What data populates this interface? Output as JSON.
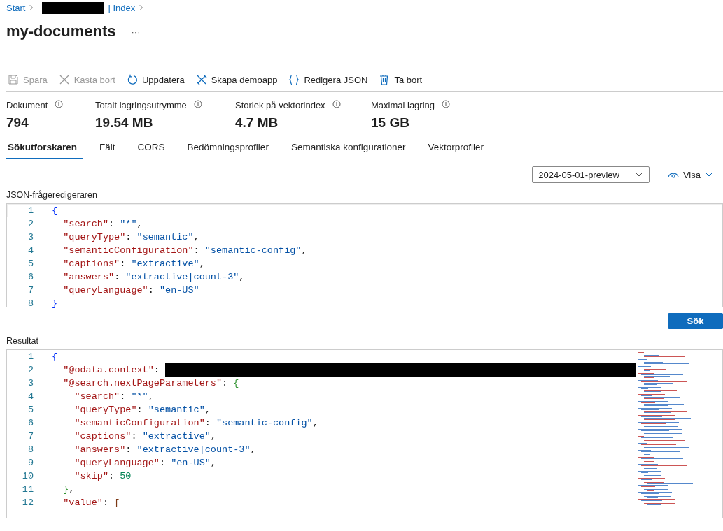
{
  "breadcrumb": [
    {
      "text": "Start",
      "kind": "link"
    },
    {
      "kind": "redacted"
    },
    {
      "text": "| Index",
      "kind": "link"
    }
  ],
  "title": "my-documents",
  "more": "···",
  "toolbar": [
    {
      "label": "Spara",
      "kind": "save",
      "disabled": true
    },
    {
      "label": "Kasta bort",
      "kind": "discard",
      "disabled": true
    },
    {
      "label": "Uppdatera",
      "kind": "refresh",
      "disabled": false
    },
    {
      "label": "Skapa demoapp",
      "kind": "tools",
      "disabled": false
    },
    {
      "label": "Redigera JSON",
      "kind": "braces",
      "disabled": false
    },
    {
      "label": "Ta bort",
      "kind": "trash",
      "disabled": false
    }
  ],
  "stats": [
    {
      "label": "Dokument",
      "value": "794"
    },
    {
      "label": "Totalt lagringsutrymme",
      "value": "19.54 MB"
    },
    {
      "label": "Storlek på vektorindex",
      "value": "4.7 MB"
    },
    {
      "label": "Maximal lagring",
      "value": "15 GB"
    }
  ],
  "tabs": [
    {
      "label": "Sökutforskaren",
      "selected": true
    },
    {
      "label": "Fält",
      "selected": false
    },
    {
      "label": "CORS",
      "selected": false
    },
    {
      "label": "Bedömningsprofiler",
      "selected": false
    },
    {
      "label": "Semantiska konfigurationer",
      "selected": false
    },
    {
      "label": "Vektorprofiler",
      "selected": false
    }
  ],
  "api_version": {
    "value": "2024-05-01-preview"
  },
  "view_button": "Visa",
  "query_editor": {
    "label": "JSON-frågeredigeraren",
    "lines": [
      {
        "number": "1",
        "tokens": [
          {
            "kind": "bracket1",
            "text": "{"
          }
        ]
      },
      {
        "number": "2",
        "tokens": [
          {
            "kind": "key",
            "text": "  \"search\""
          },
          {
            "kind": "punct",
            "text": ": "
          },
          {
            "kind": "string",
            "text": "\"*\""
          },
          {
            "kind": "punct",
            "text": ","
          }
        ]
      },
      {
        "number": "3",
        "tokens": [
          {
            "kind": "key",
            "text": "  \"queryType\""
          },
          {
            "kind": "punct",
            "text": ": "
          },
          {
            "kind": "string",
            "text": "\"semantic\""
          },
          {
            "kind": "punct",
            "text": ","
          }
        ]
      },
      {
        "number": "4",
        "tokens": [
          {
            "kind": "key",
            "text": "  \"semanticConfiguration\""
          },
          {
            "kind": "punct",
            "text": ": "
          },
          {
            "kind": "string",
            "text": "\"semantic-config\""
          },
          {
            "kind": "punct",
            "text": ","
          }
        ]
      },
      {
        "number": "5",
        "tokens": [
          {
            "kind": "key",
            "text": "  \"captions\""
          },
          {
            "kind": "punct",
            "text": ": "
          },
          {
            "kind": "string",
            "text": "\"extractive\""
          },
          {
            "kind": "punct",
            "text": ","
          }
        ]
      },
      {
        "number": "6",
        "tokens": [
          {
            "kind": "key",
            "text": "  \"answers\""
          },
          {
            "kind": "punct",
            "text": ": "
          },
          {
            "kind": "string",
            "text": "\"extractive|count-3\""
          },
          {
            "kind": "punct",
            "text": ","
          }
        ]
      },
      {
        "number": "7",
        "tokens": [
          {
            "kind": "key",
            "text": "  \"queryLanguage\""
          },
          {
            "kind": "punct",
            "text": ": "
          },
          {
            "kind": "string",
            "text": "\"en-US\""
          }
        ]
      },
      {
        "number": "8",
        "tokens": [
          {
            "kind": "bracket1",
            "text": "}"
          }
        ]
      }
    ]
  },
  "search_button": "Sök",
  "results": {
    "label": "Resultat",
    "lines": [
      {
        "number": "1",
        "tokens": [
          {
            "kind": "bracket1",
            "text": "{"
          }
        ]
      },
      {
        "number": "2",
        "tokens": [
          {
            "kind": "key",
            "text": "  \"@odata.context\""
          },
          {
            "kind": "punct",
            "text": ": "
          },
          {
            "kind": "redacted"
          }
        ]
      },
      {
        "number": "3",
        "tokens": [
          {
            "kind": "key",
            "text": "  \"@search.nextPageParameters\""
          },
          {
            "kind": "punct",
            "text": ": "
          },
          {
            "kind": "bracket2",
            "text": "{"
          }
        ]
      },
      {
        "number": "4",
        "tokens": [
          {
            "kind": "key",
            "text": "    \"search\""
          },
          {
            "kind": "punct",
            "text": ": "
          },
          {
            "kind": "string",
            "text": "\"*\""
          },
          {
            "kind": "punct",
            "text": ","
          }
        ]
      },
      {
        "number": "5",
        "tokens": [
          {
            "kind": "key",
            "text": "    \"queryType\""
          },
          {
            "kind": "punct",
            "text": ": "
          },
          {
            "kind": "string",
            "text": "\"semantic\""
          },
          {
            "kind": "punct",
            "text": ","
          }
        ]
      },
      {
        "number": "6",
        "tokens": [
          {
            "kind": "key",
            "text": "    \"semanticConfiguration\""
          },
          {
            "kind": "punct",
            "text": ": "
          },
          {
            "kind": "string",
            "text": "\"semantic-config\""
          },
          {
            "kind": "punct",
            "text": ","
          }
        ]
      },
      {
        "number": "7",
        "tokens": [
          {
            "kind": "key",
            "text": "    \"captions\""
          },
          {
            "kind": "punct",
            "text": ": "
          },
          {
            "kind": "string",
            "text": "\"extractive\""
          },
          {
            "kind": "punct",
            "text": ","
          }
        ]
      },
      {
        "number": "8",
        "tokens": [
          {
            "kind": "key",
            "text": "    \"answers\""
          },
          {
            "kind": "punct",
            "text": ": "
          },
          {
            "kind": "string",
            "text": "\"extractive|count-3\""
          },
          {
            "kind": "punct",
            "text": ","
          }
        ]
      },
      {
        "number": "9",
        "tokens": [
          {
            "kind": "key",
            "text": "    \"queryLanguage\""
          },
          {
            "kind": "punct",
            "text": ": "
          },
          {
            "kind": "string",
            "text": "\"en-US\""
          },
          {
            "kind": "punct",
            "text": ","
          }
        ]
      },
      {
        "number": "10",
        "tokens": [
          {
            "kind": "key",
            "text": "    \"skip\""
          },
          {
            "kind": "punct",
            "text": ": "
          },
          {
            "kind": "number",
            "text": "50"
          }
        ]
      },
      {
        "number": "11",
        "tokens": [
          {
            "kind": "bracket2",
            "text": "  }"
          },
          {
            "kind": "punct",
            "text": ","
          }
        ]
      },
      {
        "number": "12",
        "tokens": [
          {
            "kind": "key",
            "text": "  \"value\""
          },
          {
            "kind": "punct",
            "text": ": "
          },
          {
            "kind": "bracket3",
            "text": "["
          }
        ]
      }
    ]
  }
}
